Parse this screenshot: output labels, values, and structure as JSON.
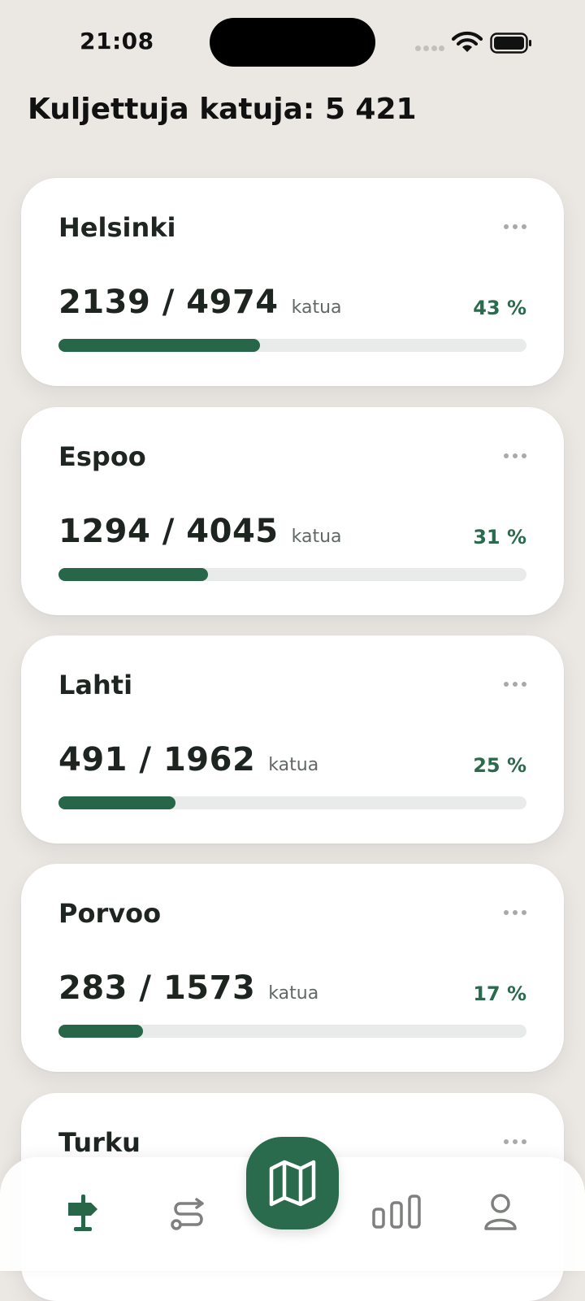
{
  "status": {
    "time": "21:08"
  },
  "header": {
    "title": "Kuljettuja katuja: 5 421"
  },
  "cities": [
    {
      "name": "Helsinki",
      "count": "2139 / 4974",
      "unit": "katua",
      "percent_label": "43 %",
      "progress": 0.43
    },
    {
      "name": "Espoo",
      "count": "1294 / 4045",
      "unit": "katua",
      "percent_label": "31 %",
      "progress": 0.32
    },
    {
      "name": "Lahti",
      "count": "491 / 1962",
      "unit": "katua",
      "percent_label": "25 %",
      "progress": 0.25
    },
    {
      "name": "Porvoo",
      "count": "283 / 1573",
      "unit": "katua",
      "percent_label": "17 %",
      "progress": 0.18
    },
    {
      "name": "Turku",
      "count": "",
      "unit": "",
      "percent_label": "",
      "progress": 0
    }
  ],
  "tabbar": {
    "tabs": [
      {
        "icon": "signpost-icon",
        "active": true
      },
      {
        "icon": "route-icon",
        "active": false
      },
      {
        "icon": "map-icon",
        "active": false
      },
      {
        "icon": "bar-chart-icon",
        "active": false
      },
      {
        "icon": "profile-icon",
        "active": false
      }
    ]
  },
  "colors": {
    "accent": "#28664a",
    "track": "#e8ebe9",
    "background": "#ebe8e4",
    "card": "#ffffff"
  }
}
